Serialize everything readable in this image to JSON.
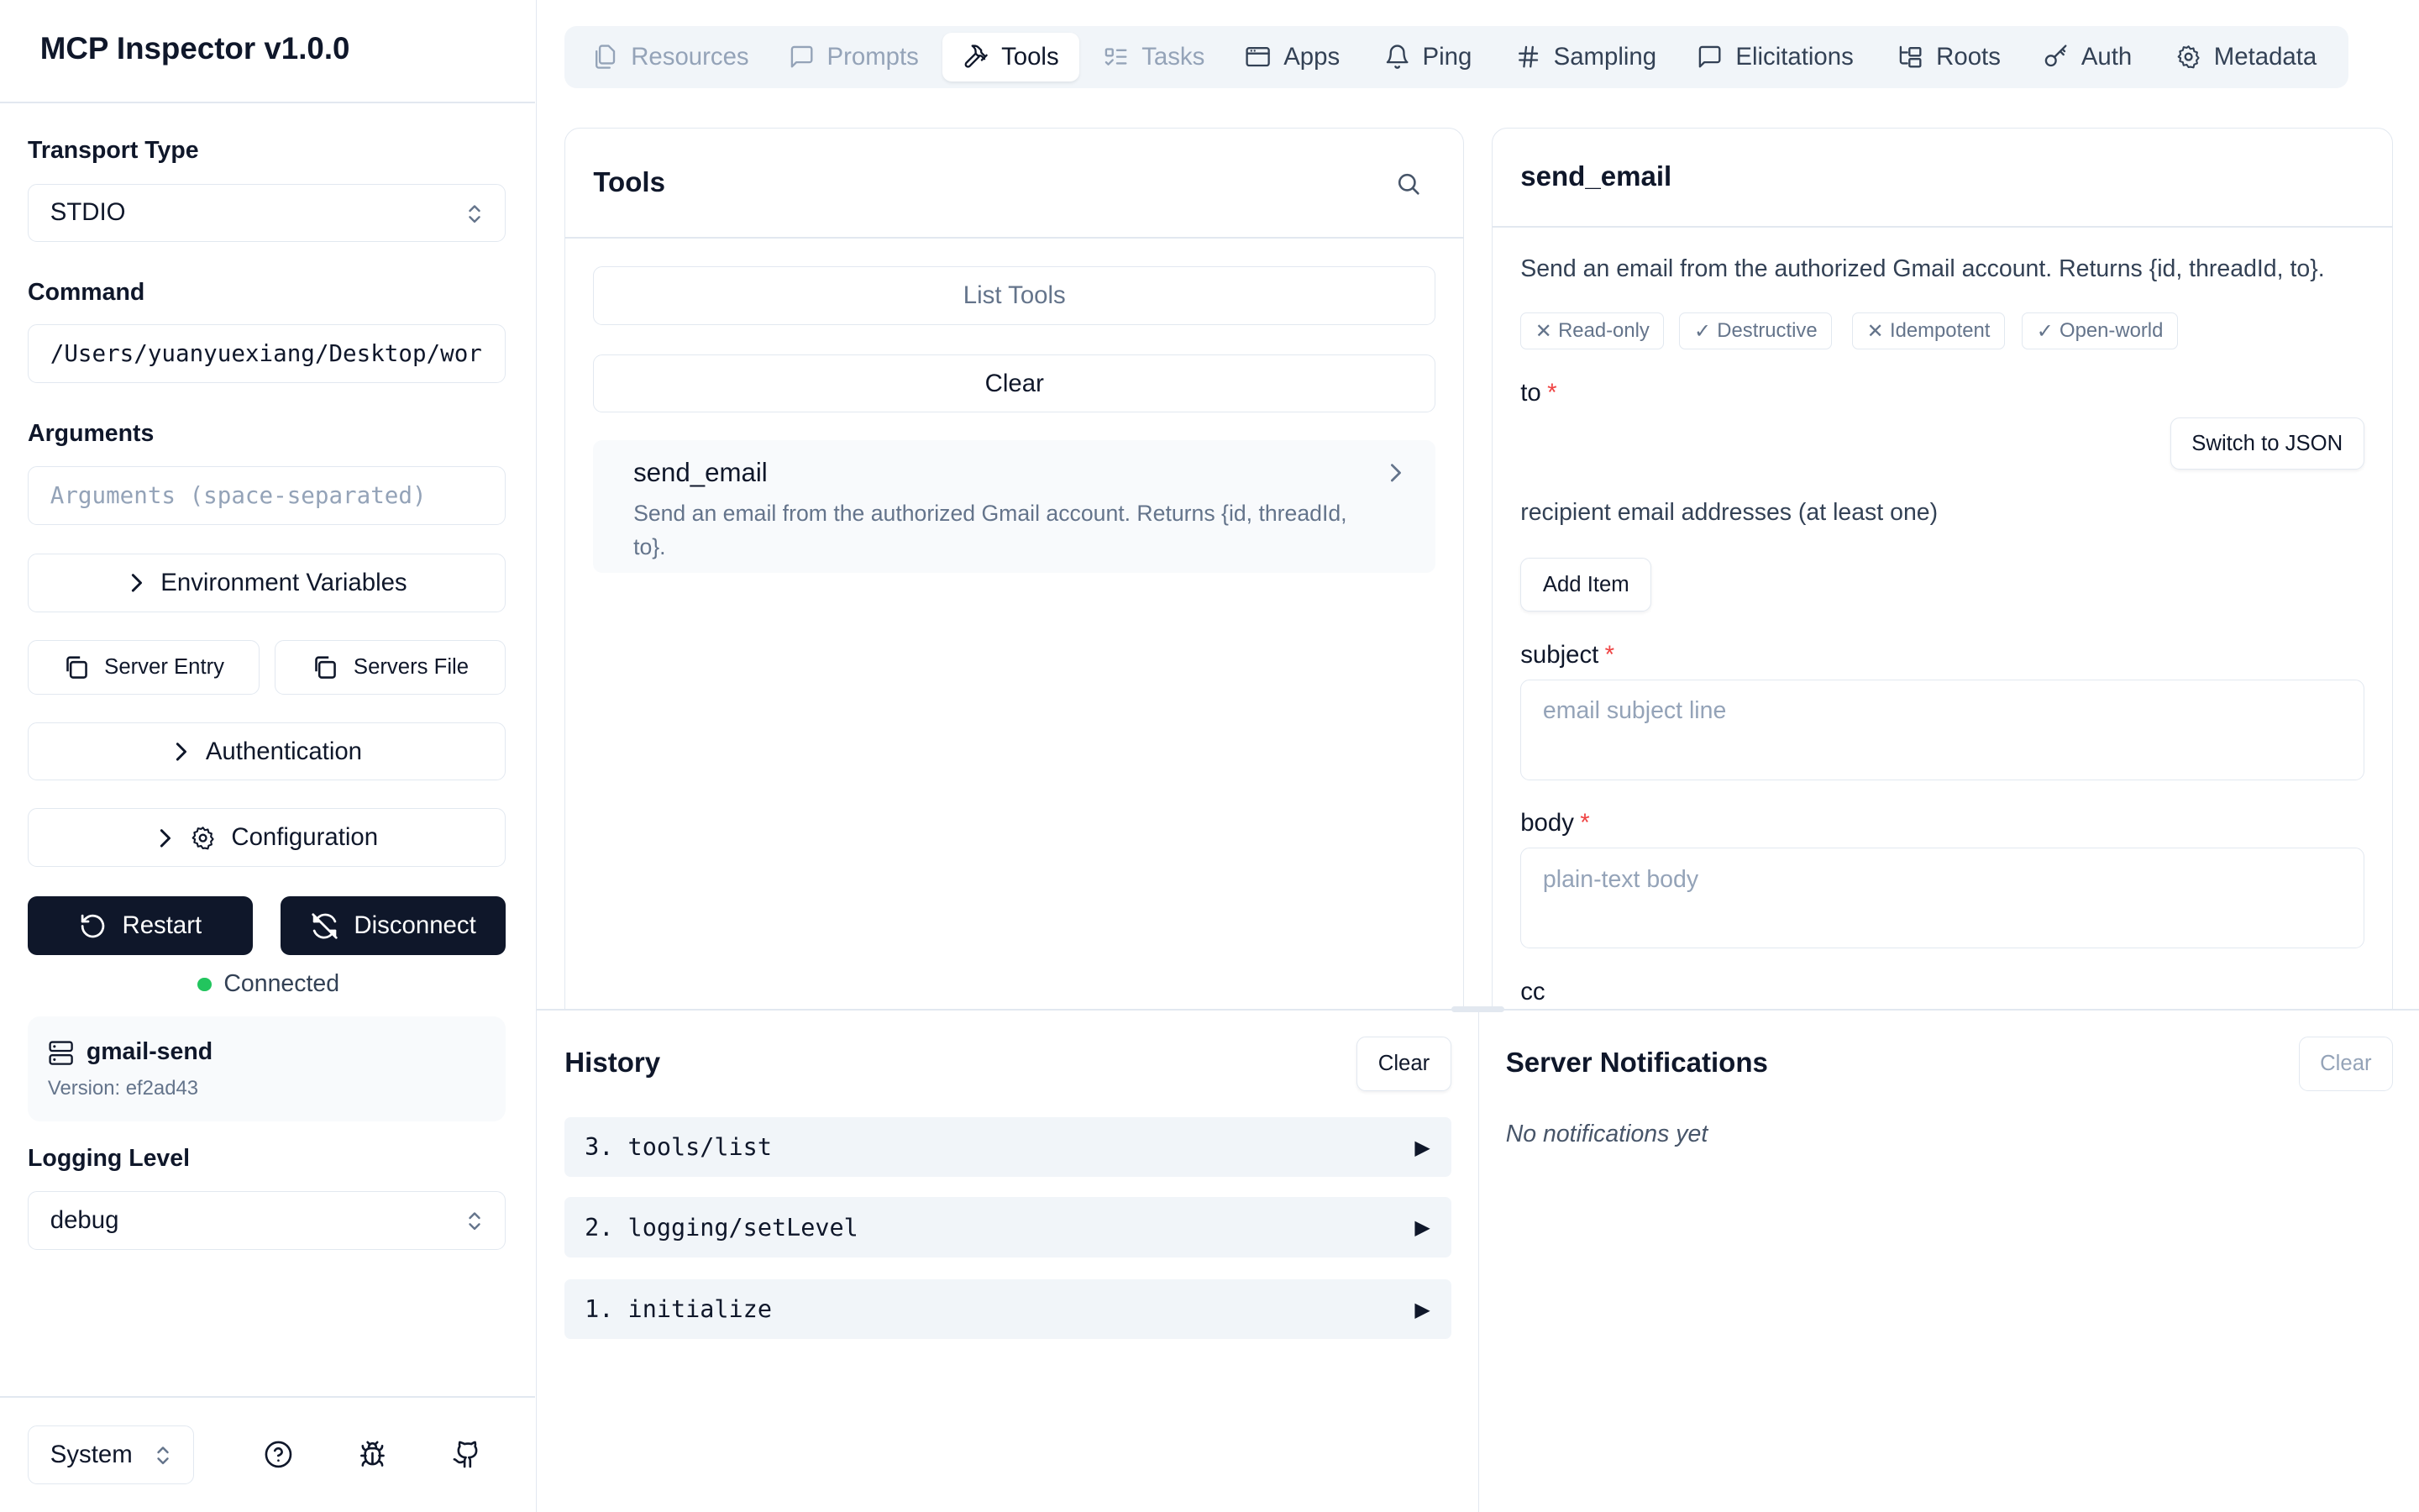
{
  "app": {
    "title": "MCP Inspector v1.0.0"
  },
  "sidebar": {
    "transport_label": "Transport Type",
    "transport_value": "STDIO",
    "command_label": "Command",
    "command_value": "/Users/yuanyuexiang/Desktop/wor",
    "arguments_label": "Arguments",
    "arguments_placeholder": "Arguments (space-separated)",
    "env_vars": "Environment Variables",
    "server_entry": "Server Entry",
    "servers_file": "Servers File",
    "authentication": "Authentication",
    "configuration": "Configuration",
    "restart": "Restart",
    "disconnect": "Disconnect",
    "status": "Connected",
    "server_name": "gmail-send",
    "server_version": "Version: ef2ad43",
    "logging_label": "Logging Level",
    "logging_value": "debug",
    "theme_value": "System"
  },
  "tabs": [
    {
      "label": "Resources",
      "icon": "files-icon",
      "state": "disabled"
    },
    {
      "label": "Prompts",
      "icon": "message-square-icon",
      "state": "disabled"
    },
    {
      "label": "Tools",
      "icon": "hammer-icon",
      "state": "active"
    },
    {
      "label": "Tasks",
      "icon": "list-todo-icon",
      "state": "disabled"
    },
    {
      "label": "Apps",
      "icon": "app-window-icon",
      "state": "normal"
    },
    {
      "label": "Ping",
      "icon": "bell-icon",
      "state": "normal"
    },
    {
      "label": "Sampling",
      "icon": "hash-icon",
      "state": "normal"
    },
    {
      "label": "Elicitations",
      "icon": "message-square-icon",
      "state": "normal"
    },
    {
      "label": "Roots",
      "icon": "folder-tree-icon",
      "state": "normal"
    },
    {
      "label": "Auth",
      "icon": "key-icon",
      "state": "normal"
    },
    {
      "label": "Metadata",
      "icon": "gear-icon",
      "state": "normal"
    }
  ],
  "tools_panel": {
    "title": "Tools",
    "list_tools": "List Tools",
    "clear": "Clear",
    "items": [
      {
        "name": "send_email",
        "description": "Send an email from the authorized Gmail account. Returns {id, threadId, to}."
      }
    ]
  },
  "detail": {
    "title": "send_email",
    "description": "Send an email from the authorized Gmail account. Returns {id, threadId, to}.",
    "badges": [
      {
        "mark": "✕",
        "label": "Read-only"
      },
      {
        "mark": "✓",
        "label": "Destructive"
      },
      {
        "mark": "✕",
        "label": "Idempotent"
      },
      {
        "mark": "✓",
        "label": "Open-world"
      }
    ],
    "to_label": "to",
    "required_mark": "*",
    "switch_json": "Switch to JSON",
    "to_description": "recipient email addresses (at least one)",
    "add_item": "Add Item",
    "subject_label": "subject",
    "subject_placeholder": "email subject line",
    "body_label": "body",
    "body_placeholder": "plain-text body",
    "cc_label": "cc"
  },
  "history": {
    "title": "History",
    "clear": "Clear",
    "items": [
      "3. tools/list",
      "2. logging/setLevel",
      "1. initialize"
    ]
  },
  "notifications": {
    "title": "Server Notifications",
    "clear": "Clear",
    "empty": "No notifications yet"
  },
  "colors": {
    "primary_dark": "#0f172a",
    "status_green": "#22c55e",
    "required_red": "#ef4444",
    "border": "#e2e8f0"
  }
}
